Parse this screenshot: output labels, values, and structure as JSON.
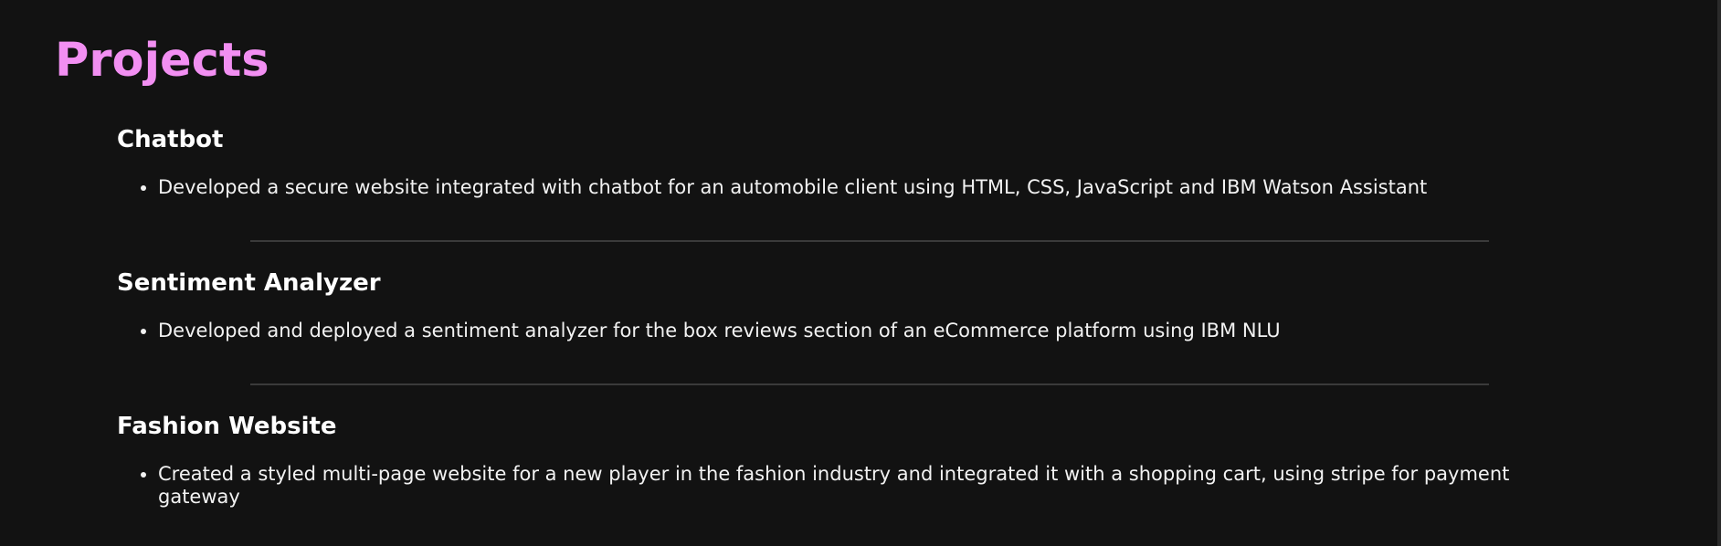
{
  "section": {
    "title": "Projects"
  },
  "projects": [
    {
      "title": "Chatbot",
      "bullet": "Developed a secure website integrated with chatbot for an automobile client using HTML, CSS, JavaScript and IBM Watson Assistant"
    },
    {
      "title": "Sentiment Analyzer",
      "bullet": "Developed and deployed a sentiment analyzer for the box reviews section of an eCommerce platform using IBM NLU"
    },
    {
      "title": "Fashion Website",
      "bullet": "Created a styled multi-page website for a new player in the fashion industry and integrated it with a shopping cart, using stripe for payment gateway"
    }
  ],
  "colors": {
    "background": "#121212",
    "accent": "#f28ff2",
    "heading": "#ffffff",
    "text": "#f2f2f2",
    "divider": "#3a3a3a"
  }
}
